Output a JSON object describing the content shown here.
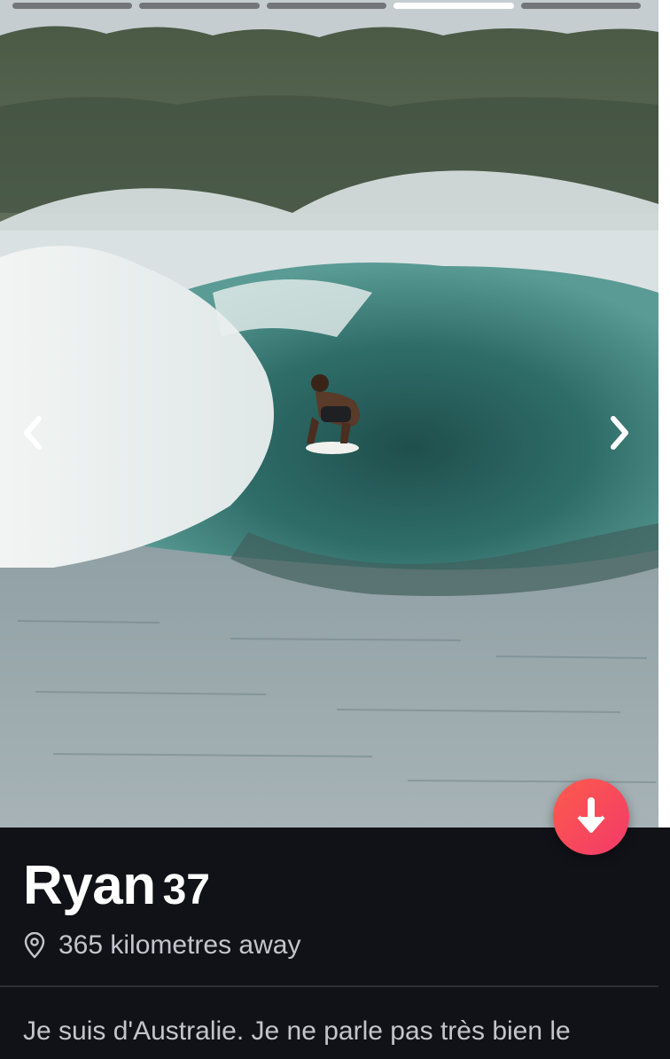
{
  "photo": {
    "total_photos": 5,
    "current_photo": 4,
    "alt": "surf-photo"
  },
  "colors": {
    "accent_gradient_start": "#fd5b4c",
    "accent_gradient_end": "#f23a69",
    "background": "#111217",
    "text_primary": "#ffffff",
    "text_secondary": "#c3c5cc"
  },
  "profile": {
    "name": "Ryan",
    "age": "37",
    "distance": "365 kilometres away",
    "bio": "Je suis d'Australie. Je ne parle pas très bien le"
  },
  "icons": {
    "prev": "chevron-left-icon",
    "next": "chevron-right-icon",
    "collapse": "arrow-down-icon",
    "location": "location-pin-icon"
  }
}
